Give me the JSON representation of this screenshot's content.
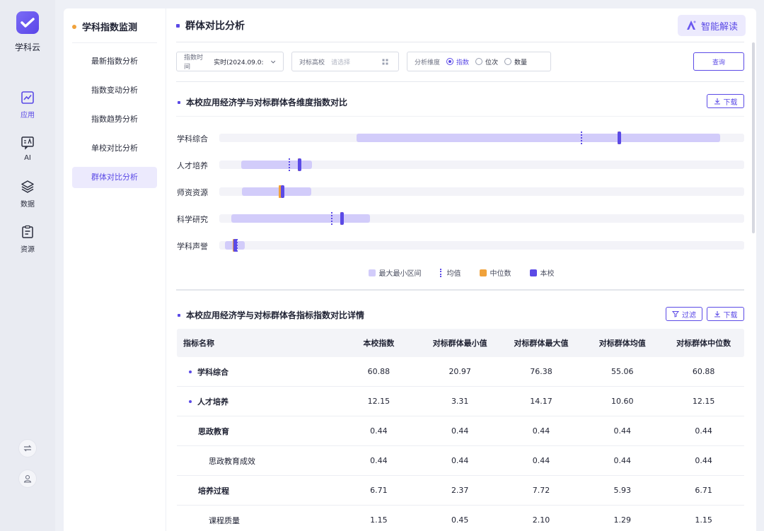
{
  "app": {
    "brand": "学科云"
  },
  "rail": {
    "items": [
      {
        "label": "应用",
        "icon": "chart-icon",
        "active": true
      },
      {
        "label": "AI",
        "icon": "ai-chat-icon",
        "active": false
      },
      {
        "label": "数据",
        "icon": "layers-icon",
        "active": false
      },
      {
        "label": "资源",
        "icon": "clipboard-icon",
        "active": false
      }
    ],
    "bottom_icons": [
      "switch-icon",
      "user-icon"
    ]
  },
  "sidebar": {
    "title": "学科指数监测",
    "items": [
      {
        "label": "最新指数分析",
        "active": false
      },
      {
        "label": "指数变动分析",
        "active": false
      },
      {
        "label": "指数趋势分析",
        "active": false
      },
      {
        "label": "单校对比分析",
        "active": false
      },
      {
        "label": "群体对比分析",
        "active": true
      }
    ]
  },
  "page": {
    "title": "群体对比分析",
    "ai_button": "智能解读",
    "filters": {
      "time_key": "指数时间",
      "time_value": "实时(2024.09.0:",
      "school_key": "对标高校",
      "school_placeholder": "请选择",
      "dim_key": "分析维度",
      "dim_options": [
        "指数",
        "位次",
        "数量"
      ],
      "dim_selected": "指数",
      "query": "查询"
    }
  },
  "chart_section": {
    "title": "本校应用经济学与对标群体各维度指数对比",
    "download": "下载"
  },
  "chart_data": {
    "type": "range",
    "categories": [
      "学科综合",
      "人才培养",
      "师资资源",
      "科学研究",
      "学科声誉"
    ],
    "series": [
      {
        "name": "最大最小区间",
        "values": [
          [
            20.97,
            76.38
          ],
          [
            3.31,
            14.17
          ],
          [
            3.5,
            14.0
          ],
          [
            1.8,
            23.0
          ],
          [
            0.9,
            3.9
          ]
        ]
      },
      {
        "name": "均值",
        "values": [
          55.06,
          10.6,
          9.5,
          17.0,
          2.6
        ]
      },
      {
        "name": "中位数",
        "values": [
          60.88,
          12.15,
          9.3,
          18.6,
          2.3
        ]
      },
      {
        "name": "本校",
        "values": [
          60.88,
          12.15,
          9.6,
          18.7,
          2.4
        ]
      }
    ],
    "xlim": [
      0,
      80
    ],
    "legend": [
      "最大最小区间",
      "均值",
      "中位数",
      "本校"
    ],
    "colors": {
      "range": "#d2ccfa",
      "mean": "#5b4ae6",
      "median": "#f0a23b",
      "school": "#5b4ae6"
    }
  },
  "table_section": {
    "title": "本校应用经济学与对标群体各指标指数对比详情",
    "filter": "过滤",
    "download": "下载",
    "columns": [
      "指标名称",
      "本校指数",
      "对标群体最小值",
      "对标群体最大值",
      "对标群体均值",
      "对标群体中位数"
    ],
    "rows": [
      {
        "level": 1,
        "cells": [
          "学科综合",
          "60.88",
          "20.97",
          "76.38",
          "55.06",
          "60.88"
        ]
      },
      {
        "level": 1,
        "cells": [
          "人才培养",
          "12.15",
          "3.31",
          "14.17",
          "10.60",
          "12.15"
        ]
      },
      {
        "level": 2,
        "cells": [
          "思政教育",
          "0.44",
          "0.44",
          "0.44",
          "0.44",
          "0.44"
        ]
      },
      {
        "level": 3,
        "cells": [
          "思政教育成效",
          "0.44",
          "0.44",
          "0.44",
          "0.44",
          "0.44"
        ]
      },
      {
        "level": 2,
        "cells": [
          "培养过程",
          "6.71",
          "2.37",
          "7.72",
          "5.93",
          "6.71"
        ]
      },
      {
        "level": 3,
        "cells": [
          "课程质量",
          "1.15",
          "0.45",
          "2.10",
          "1.29",
          "1.15"
        ]
      }
    ]
  }
}
